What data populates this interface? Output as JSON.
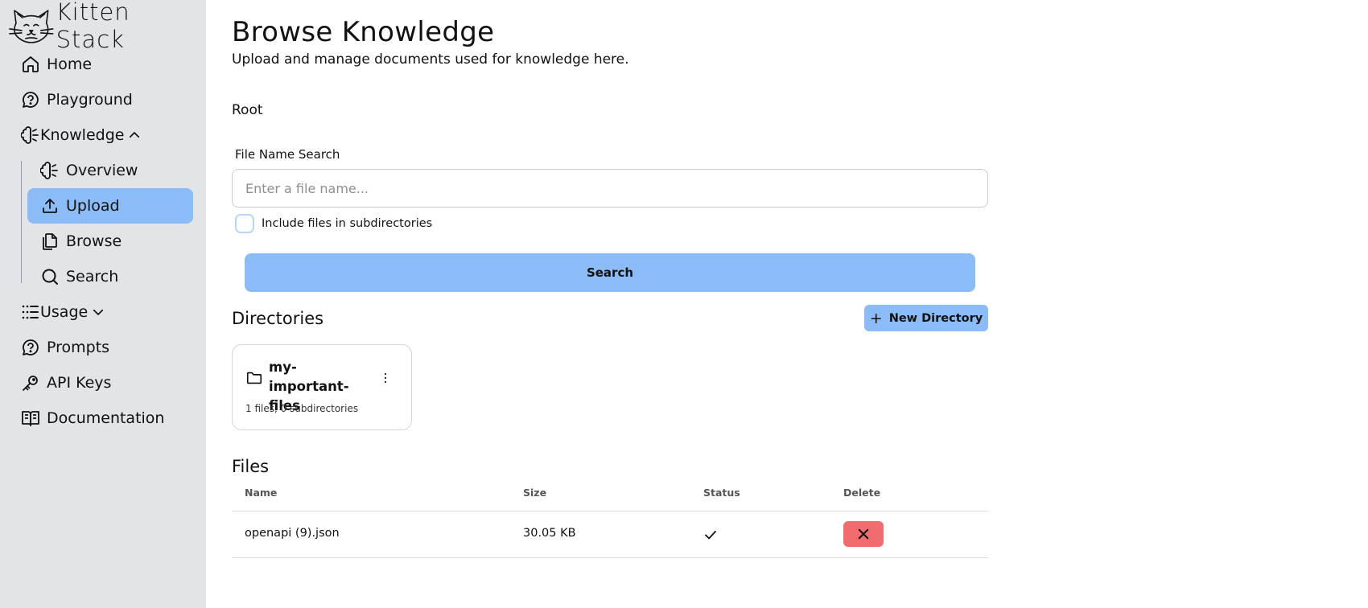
{
  "brand": {
    "name": "Kitten Stack"
  },
  "sidebar": {
    "items": [
      {
        "label": "Home",
        "icon": "home-icon"
      },
      {
        "label": "Playground",
        "icon": "chat-bubble-icon"
      },
      {
        "label": "Knowledge",
        "icon": "brain-icon",
        "expanded": true
      },
      {
        "label": "Overview",
        "icon": "brain-icon"
      },
      {
        "label": "Upload",
        "icon": "upload-icon",
        "active": true
      },
      {
        "label": "Browse",
        "icon": "files-icon"
      },
      {
        "label": "Search",
        "icon": "search-icon"
      },
      {
        "label": "Usage",
        "icon": "list-icon",
        "expanded": false
      },
      {
        "label": "Prompts",
        "icon": "chat-bubble-icon"
      },
      {
        "label": "API Keys",
        "icon": "key-icon"
      },
      {
        "label": "Documentation",
        "icon": "book-icon"
      }
    ]
  },
  "page": {
    "title": "Browse Knowledge",
    "subtitle": "Upload and manage documents used for knowledge here.",
    "breadcrumb": "Root"
  },
  "search": {
    "label": "File Name Search",
    "placeholder": "Enter a file name...",
    "value": "",
    "include_subdirs_label": "Include files in subdirectories",
    "include_subdirs_checked": false,
    "button_label": "Search"
  },
  "directories": {
    "heading": "Directories",
    "new_button_label": "New Directory",
    "items": [
      {
        "name": "my-important-files",
        "meta": "1 files, 0 subdirectories"
      }
    ]
  },
  "files": {
    "heading": "Files",
    "columns": [
      "Name",
      "Size",
      "Status",
      "Delete"
    ],
    "rows": [
      {
        "name": "openapi (9).json",
        "size": "30.05 KB",
        "status": "ready"
      }
    ]
  },
  "colors": {
    "sidebar_bg": "#e3e4e8",
    "accent": "#8bbcf7",
    "danger": "#f26b6e"
  }
}
